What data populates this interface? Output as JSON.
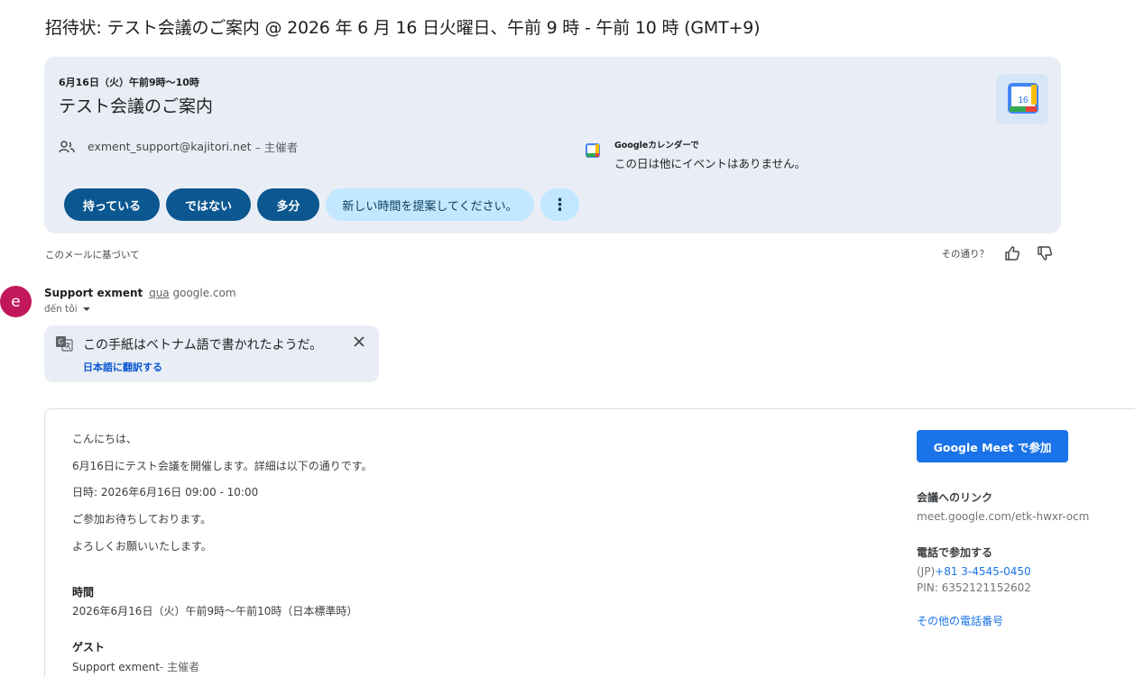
{
  "subject": "招待状: テスト会議のご案内 @ 2026 年 6 月 16 日火曜日、午前 9 時 - 午前 10 時 (GMT+9)",
  "invite": {
    "date": "6月16日（火）午前9時〜10時",
    "title": "テスト会議のご案内",
    "organizer_email": "exment_support@kajitori.net",
    "organizer_role": "– 主催者",
    "gcal_heading": "Googleカレンダーで",
    "gcal_status": "この日は他にイベントはありません。",
    "calendar_day": "16",
    "rsvp": {
      "yes": "持っている",
      "no": "ではない",
      "maybe": "多分",
      "propose": "新しい時間を提案してください。"
    }
  },
  "feedback": {
    "based_on": "このメールに基づいて",
    "question": "その通り？"
  },
  "sender": {
    "avatar": "e",
    "name": "Support exment",
    "via": "qua",
    "domain": "google.com",
    "to": "đến tôi"
  },
  "translate": {
    "message": "この手紙はベトナム語で書かれたようだ。",
    "action": "日本語に翻訳する"
  },
  "body": {
    "lines": [
      "こんにちは、",
      "6月16日にテスト会議を開催します。詳細は以下の通りです。",
      "日時: 2026年6月16日 09:00 - 10:00",
      "ご参加お待ちしております。",
      "よろしくお願いいたします。"
    ],
    "time_heading": "時間",
    "time_value": "2026年6月16日（火）午前9時〜午前10時（日本標準時）",
    "guests_heading": "ゲスト",
    "guest_name": "Support exment",
    "guest_role": "- 主催者"
  },
  "side": {
    "meet_button": "Google Meet で参加",
    "link_heading": "会議へのリンク",
    "link_url": "meet.google.com/etk-hwxr-ocm",
    "phone_heading": "電話で参加する",
    "phone_prefix": "(JP)",
    "phone_number": "+81 3-4545-0450",
    "pin": "PIN: 6352121152602",
    "more_numbers": "その他の電話番号"
  }
}
